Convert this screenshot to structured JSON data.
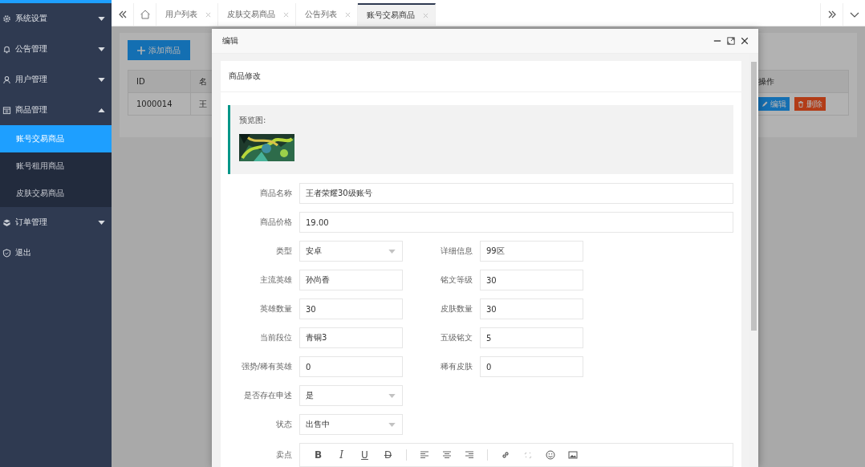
{
  "sidebar": {
    "items": [
      {
        "label": "系统设置",
        "expanded": false
      },
      {
        "label": "公告管理",
        "expanded": false
      },
      {
        "label": "用户管理",
        "expanded": false
      },
      {
        "label": "商品管理",
        "expanded": true,
        "children": [
          {
            "label": "账号交易商品",
            "selected": true
          },
          {
            "label": "账号租用商品",
            "selected": false
          },
          {
            "label": "皮肤交易商品",
            "selected": false
          }
        ]
      },
      {
        "label": "订单管理",
        "expanded": false
      },
      {
        "label": "退出"
      }
    ]
  },
  "tabs": [
    {
      "label": "用户列表",
      "selected": false
    },
    {
      "label": "皮肤交易商品",
      "selected": false
    },
    {
      "label": "公告列表",
      "selected": false
    },
    {
      "label": "账号交易商品",
      "selected": true
    }
  ],
  "page": {
    "add_button": "添加商品",
    "table": {
      "columns": [
        "ID",
        "名",
        "操作"
      ],
      "rows": [
        {
          "cells": [
            "1000014",
            "王"
          ],
          "actions": [
            "编辑",
            "删除"
          ]
        }
      ]
    }
  },
  "modal": {
    "title": "编辑",
    "card_title": "商品修改",
    "preview_label": "预览图:",
    "preview": {
      "kind": "picture"
    },
    "wide_fields": [
      {
        "label": "商品名称",
        "value": "王者荣耀30级账号",
        "kind": "text"
      },
      {
        "label": "商品价格",
        "value": "19.00",
        "kind": "text"
      }
    ],
    "rows": [
      [
        {
          "label": "类型",
          "value": "安卓",
          "kind": "select"
        },
        {
          "label": "详细信息",
          "value": "99区",
          "kind": "text"
        }
      ],
      [
        {
          "label": "主流英雄",
          "value": "孙尚香",
          "kind": "text"
        },
        {
          "label": "铭文等级",
          "value": "30",
          "kind": "text"
        }
      ],
      [
        {
          "label": "英雄数量",
          "value": "30",
          "kind": "text"
        },
        {
          "label": "皮肤数量",
          "value": "30",
          "kind": "text"
        }
      ],
      [
        {
          "label": "当前段位",
          "value": "青铜3",
          "kind": "text"
        },
        {
          "label": "五级铭文",
          "value": "5",
          "kind": "text"
        }
      ],
      [
        {
          "label": "强势/稀有英雄",
          "value": "0",
          "kind": "text"
        },
        {
          "label": "稀有皮肤",
          "value": "0",
          "kind": "text"
        }
      ],
      [
        {
          "label": "是否存在申述",
          "value": "是",
          "kind": "select"
        }
      ],
      [
        {
          "label": "状态",
          "value": "出售中",
          "kind": "select"
        }
      ]
    ],
    "editor": {
      "label": "卖点",
      "format_buttons": [
        {
          "text": "B",
          "kind": "bold"
        },
        {
          "text": "I",
          "kind": "italic"
        },
        {
          "text": "U",
          "kind": "underline"
        },
        {
          "text": "D",
          "kind": "strike"
        }
      ]
    }
  }
}
